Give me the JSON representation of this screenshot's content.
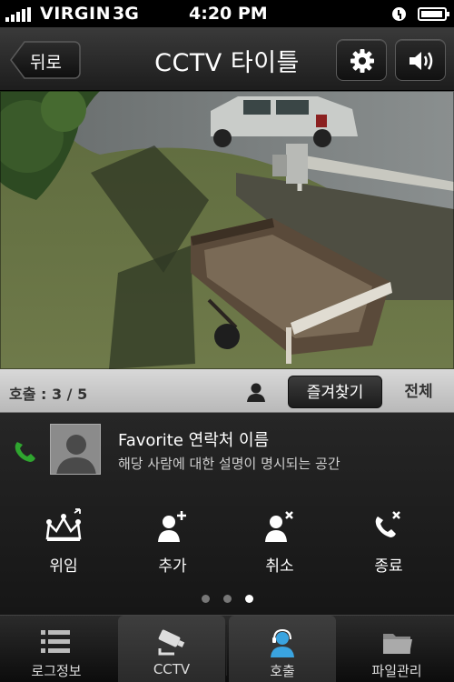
{
  "status_bar": {
    "carrier": "VIRGIN",
    "network": "3G",
    "time": "4:20 PM",
    "icons": [
      "signal-icon",
      "alarm-icon",
      "battery-icon"
    ]
  },
  "nav": {
    "back_label": "뒤로",
    "title": "CCTV 타이틀",
    "settings_icon": "gear-icon",
    "sound_icon": "speaker-icon"
  },
  "calls_bar": {
    "count_label": "호출 : 3 / 5",
    "favorites_label": "즐겨찾기",
    "all_label": "전체"
  },
  "contact": {
    "name": "Favorite 연락처 이름",
    "description": "해당 사람에 대한 설명이 명시되는 공간",
    "actions": [
      {
        "label": "위임",
        "icon": "crown-icon"
      },
      {
        "label": "추가",
        "icon": "add-person-icon"
      },
      {
        "label": "취소",
        "icon": "remove-person-icon"
      },
      {
        "label": "종료",
        "icon": "end-call-icon"
      }
    ],
    "page_dots": {
      "count": 3,
      "active_index": 2
    }
  },
  "tabs": [
    {
      "label": "로그정보",
      "icon": "list-icon"
    },
    {
      "label": "CCTV",
      "icon": "camera-icon"
    },
    {
      "label": "호출",
      "icon": "headset-person-icon",
      "active": true
    },
    {
      "label": "파일관리",
      "icon": "folder-icon"
    }
  ],
  "colors": {
    "accent_green": "#2fa52f",
    "active_tab_blue": "#3aa4e0"
  }
}
